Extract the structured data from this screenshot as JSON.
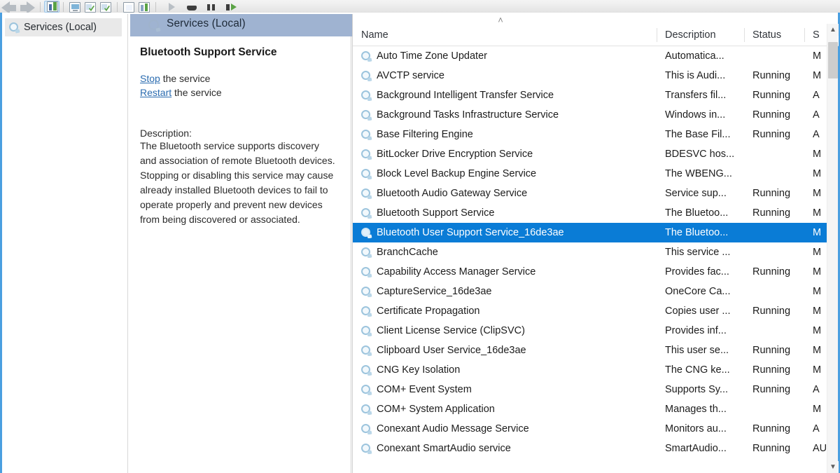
{
  "toolbar": {
    "back_label": "Back",
    "forward_label": "Forward",
    "buttons": [
      {
        "name": "show-hide-console-tree",
        "label": "Show/Hide Console Tree"
      },
      {
        "name": "export-list",
        "label": "Export List"
      },
      {
        "name": "refresh",
        "label": "Refresh"
      },
      {
        "name": "new-window",
        "label": "New Window from Here"
      },
      {
        "name": "properties",
        "label": "Properties"
      },
      {
        "name": "help",
        "label": "Help"
      },
      {
        "name": "start-service",
        "label": "Start Service"
      },
      {
        "name": "stop-service",
        "label": "Stop Service"
      },
      {
        "name": "pause-service",
        "label": "Pause Service"
      },
      {
        "name": "restart-service",
        "label": "Restart Service"
      }
    ]
  },
  "tree": {
    "root_label": "Services (Local)",
    "icon": "services-gear-icon"
  },
  "header": {
    "title": "Services (Local)",
    "icon": "services-gear-icon"
  },
  "details": {
    "service_title": "Bluetooth Support Service",
    "stop_link": "Stop",
    "stop_suffix": " the service",
    "restart_link": "Restart",
    "restart_suffix": " the service",
    "description_label": "Description:",
    "description_text": "The Bluetooth service supports discovery and association of remote Bluetooth devices.  Stopping or disabling this service may cause already installed Bluetooth devices to fail to operate properly and prevent new devices from being discovered or associated."
  },
  "list": {
    "sort_indicator": "˄",
    "columns": [
      {
        "key": "name",
        "label": "Name"
      },
      {
        "key": "description",
        "label": "Description"
      },
      {
        "key": "status",
        "label": "Status"
      },
      {
        "key": "startup",
        "label": "S"
      }
    ],
    "selected_index": 9,
    "selection_color": "#0a7cd6",
    "rows": [
      {
        "name": "Auto Time Zone Updater",
        "description": "Automatica...",
        "status": "",
        "startup": "M"
      },
      {
        "name": "AVCTP service",
        "description": "This is Audi...",
        "status": "Running",
        "startup": "M"
      },
      {
        "name": "Background Intelligent Transfer Service",
        "description": "Transfers fil...",
        "status": "Running",
        "startup": "A"
      },
      {
        "name": "Background Tasks Infrastructure Service",
        "description": "Windows in...",
        "status": "Running",
        "startup": "A"
      },
      {
        "name": "Base Filtering Engine",
        "description": "The Base Fil...",
        "status": "Running",
        "startup": "A"
      },
      {
        "name": "BitLocker Drive Encryption Service",
        "description": "BDESVC hos...",
        "status": "",
        "startup": "M"
      },
      {
        "name": "Block Level Backup Engine Service",
        "description": "The WBENG...",
        "status": "",
        "startup": "M"
      },
      {
        "name": "Bluetooth Audio Gateway Service",
        "description": "Service sup...",
        "status": "Running",
        "startup": "M"
      },
      {
        "name": "Bluetooth Support Service",
        "description": "The Bluetoo...",
        "status": "Running",
        "startup": "M"
      },
      {
        "name": "Bluetooth User Support Service_16de3ae",
        "description": "The Bluetoo...",
        "status": "",
        "startup": "M"
      },
      {
        "name": "BranchCache",
        "description": "This service ...",
        "status": "",
        "startup": "M"
      },
      {
        "name": "Capability Access Manager Service",
        "description": "Provides fac...",
        "status": "Running",
        "startup": "M"
      },
      {
        "name": "CaptureService_16de3ae",
        "description": "OneCore Ca...",
        "status": "",
        "startup": "M"
      },
      {
        "name": "Certificate Propagation",
        "description": "Copies user ...",
        "status": "Running",
        "startup": "M"
      },
      {
        "name": "Client License Service (ClipSVC)",
        "description": "Provides inf...",
        "status": "",
        "startup": "M"
      },
      {
        "name": "Clipboard User Service_16de3ae",
        "description": "This user se...",
        "status": "Running",
        "startup": "M"
      },
      {
        "name": "CNG Key Isolation",
        "description": "The CNG ke...",
        "status": "Running",
        "startup": "M"
      },
      {
        "name": "COM+ Event System",
        "description": "Supports Sy...",
        "status": "Running",
        "startup": "A"
      },
      {
        "name": "COM+ System Application",
        "description": "Manages th...",
        "status": "",
        "startup": "M"
      },
      {
        "name": "Conexant Audio Message Service",
        "description": "Monitors au...",
        "status": "Running",
        "startup": "A"
      },
      {
        "name": "Conexant SmartAudio service",
        "description": "SmartAudio...",
        "status": "Running",
        "startup": "AU"
      }
    ]
  },
  "scrollbar": {
    "up_arrow": "▲",
    "down_arrow": "▼"
  }
}
